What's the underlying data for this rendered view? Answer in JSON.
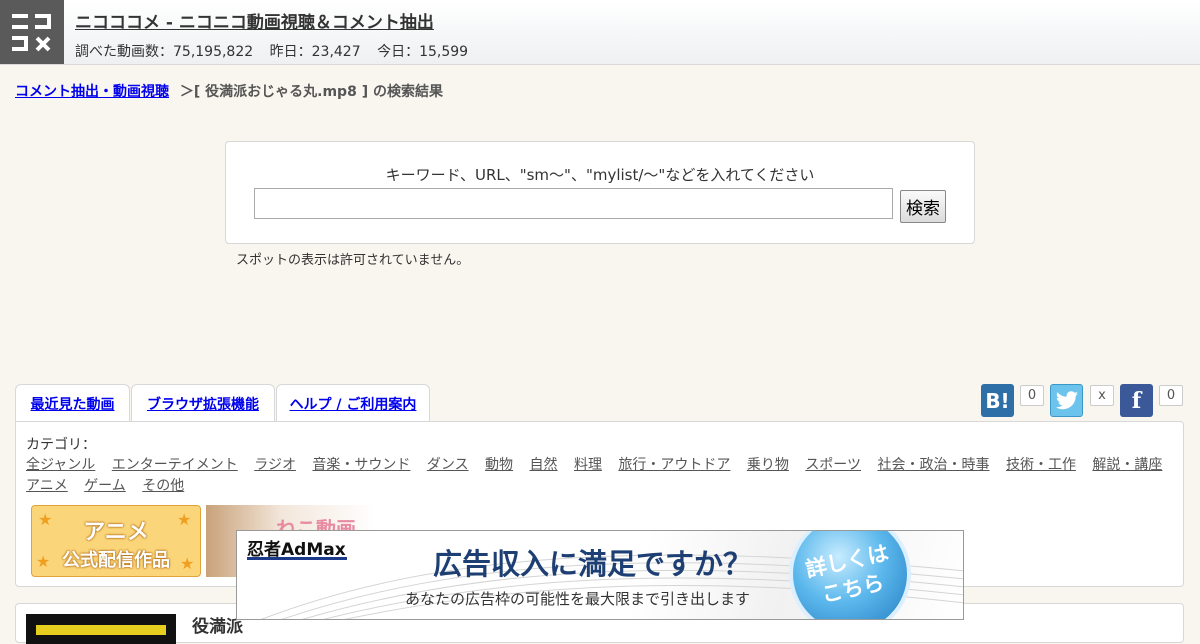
{
  "header": {
    "logo_icon": "nicocome-logo-icon",
    "title": "ニコココメ - ニコニコ動画視聴＆コメント抽出",
    "stats": {
      "total": "調べた動画数：75,195,822",
      "yesterday": "昨日：23,427",
      "today": "今日：15,599"
    }
  },
  "breadcrumb": {
    "home": "コメント抽出・動画視聴",
    "current": "＞[ 役満派おじゃる丸.mp8 ] の検索結果"
  },
  "search": {
    "hint": "キーワード、URL、\"sm〜\"、\"mylist/〜\"などを入れてください",
    "value": "",
    "placeholder": "",
    "button": "検索"
  },
  "spot_notice": "スポットの表示は許可されていません。",
  "tabs": [
    {
      "label": "最近見た動画"
    },
    {
      "label": "ブラウザ拡張機能"
    },
    {
      "label": "ヘルプ / ご利用案内"
    }
  ],
  "social": {
    "hatena": {
      "icon": "hatena-bookmark-icon",
      "glyph": "B!",
      "count": "0"
    },
    "twitter": {
      "icon": "twitter-bird-icon",
      "count": "x"
    },
    "facebook": {
      "icon": "facebook-icon",
      "glyph": "f",
      "count": "0"
    }
  },
  "categories": {
    "label": "カテゴリ：",
    "items": [
      "全ジャンル",
      "エンターテイメント",
      "ラジオ",
      "音楽・サウンド",
      "ダンス",
      "動物",
      "自然",
      "料理",
      "旅行・アウトドア",
      "乗り物",
      "スポーツ",
      "社会・政治・時事",
      "技術・工作",
      "解説・講座",
      "アニメ",
      "ゲーム",
      "その他"
    ]
  },
  "banners": {
    "anime_line1": "アニメ",
    "anime_line2": "公式配信作品",
    "neko": "ねこ動画"
  },
  "result": {
    "title": "役満派"
  },
  "ad": {
    "brand": "忍者AdMax",
    "headline": "広告収入に満足ですか？",
    "subline": "あなたの広告枠の可能性を最大限まで引き出します",
    "cta_line1": "詳しくは",
    "cta_line2": "こちら"
  },
  "colors": {
    "link": "#0000ee",
    "background": "#f9f6ef",
    "logo_bg": "#5a5a5a",
    "hatena": "#2f6fa8",
    "twitter": "#6cc4ec",
    "facebook": "#3b5998"
  }
}
